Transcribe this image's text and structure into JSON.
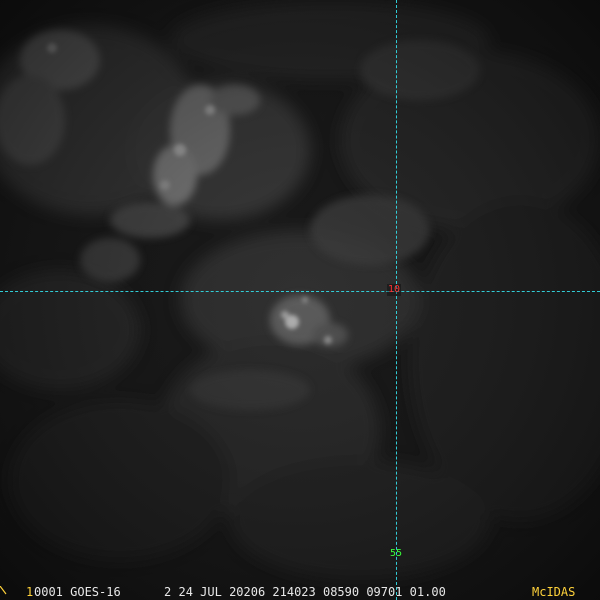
{
  "colors": {
    "background": "#141414",
    "grid_line": "#33d6e0",
    "lat_label": "#ff3030",
    "lon_label": "#39ff39",
    "status_text": "#e8e8e8",
    "status_accent": "#ffd23a"
  },
  "overlay": {
    "latitude_label": "10",
    "longitude_label": "55"
  },
  "status": {
    "frame_number": "1",
    "main_text": "0001 GOES-16      2 24 JUL 20206 214023 08590 09701 01.00",
    "brand": "McIDAS"
  },
  "icons": {
    "cursor": "cursor-corner-icon"
  }
}
